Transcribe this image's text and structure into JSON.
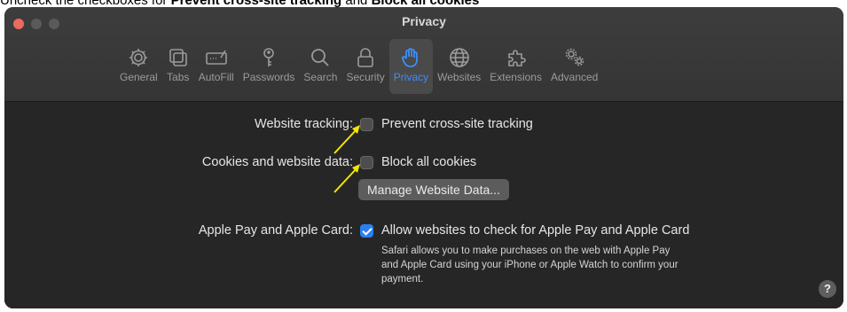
{
  "caption": {
    "prefix": "Uncheck the checkboxes for ",
    "item1": "Prevent cross-site tracking",
    "connector": " and ",
    "item2": "Block all cookies"
  },
  "window": {
    "title": "Privacy"
  },
  "toolbar": [
    {
      "label": "General",
      "icon": "gear-icon"
    },
    {
      "label": "Tabs",
      "icon": "tabs-icon"
    },
    {
      "label": "AutoFill",
      "icon": "autofill-icon"
    },
    {
      "label": "Passwords",
      "icon": "key-icon"
    },
    {
      "label": "Search",
      "icon": "search-icon"
    },
    {
      "label": "Security",
      "icon": "lock-icon"
    },
    {
      "label": "Privacy",
      "icon": "hand-icon",
      "active": true
    },
    {
      "label": "Websites",
      "icon": "globe-icon"
    },
    {
      "label": "Extensions",
      "icon": "puzzle-icon"
    },
    {
      "label": "Advanced",
      "icon": "gears-icon"
    }
  ],
  "settings": {
    "website_tracking": {
      "label": "Website tracking:",
      "option": "Prevent cross-site tracking",
      "checked": false
    },
    "cookies": {
      "label": "Cookies and website data:",
      "option": "Block all cookies",
      "checked": false,
      "button": "Manage Website Data..."
    },
    "apple_pay": {
      "label": "Apple Pay and Apple Card:",
      "option": "Allow websites to check for Apple Pay and Apple Card",
      "checked": true,
      "description_lines": [
        "Safari allows you to make purchases on the web with Apple Pay",
        "and Apple Card using your iPhone or Apple Watch to confirm your",
        "payment."
      ]
    }
  },
  "help": {
    "label": "?"
  },
  "colors": {
    "accent": "#3d8ef7",
    "annotation_arrow": "#f2e600"
  }
}
